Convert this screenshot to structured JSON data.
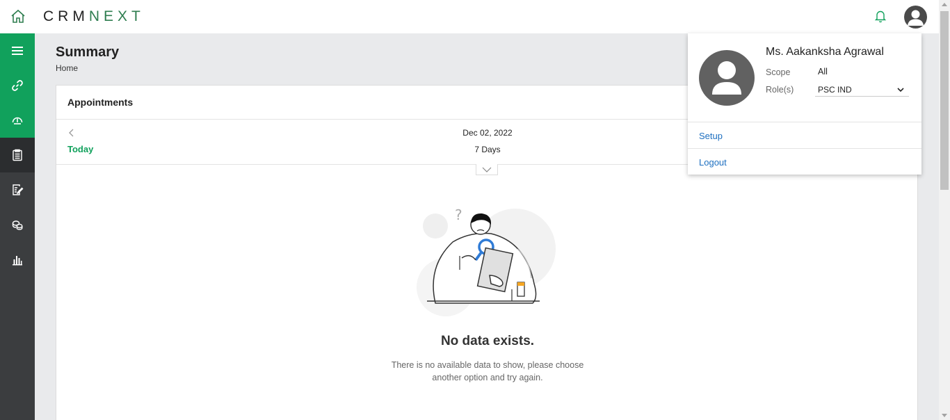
{
  "app": {
    "logo_text": "CRMNEXT",
    "accent_color": "#11a15c",
    "link_color": "#1d6fc0"
  },
  "header": {
    "icons": [
      "home-icon",
      "bell-icon",
      "user-avatar-icon"
    ]
  },
  "sidebar": {
    "items": [
      {
        "icon": "menu-icon",
        "state": "green"
      },
      {
        "icon": "link-icon",
        "state": "green"
      },
      {
        "icon": "dashboard-icon",
        "state": "green"
      },
      {
        "icon": "clipboard-icon",
        "state": "active"
      },
      {
        "icon": "edit-document-icon",
        "state": "normal"
      },
      {
        "icon": "coins-icon",
        "state": "normal"
      },
      {
        "icon": "bar-chart-icon",
        "state": "normal"
      }
    ]
  },
  "page": {
    "title": "Summary",
    "breadcrumb": "Home"
  },
  "appointments": {
    "title": "Appointments",
    "today_label": "Today",
    "date": "Dec 02, 2022",
    "range": "7 Days",
    "empty_title": "No data exists.",
    "empty_desc_line1": "There is no available data to show, please choose",
    "empty_desc_line2": "another option and try again."
  },
  "profile": {
    "name": "Ms. Aakanksha Agrawal",
    "scope_label": "Scope",
    "scope_value": "All",
    "role_label": "Role(s)",
    "role_value": "PSC IND",
    "setup_label": "Setup",
    "logout_label": "Logout"
  }
}
